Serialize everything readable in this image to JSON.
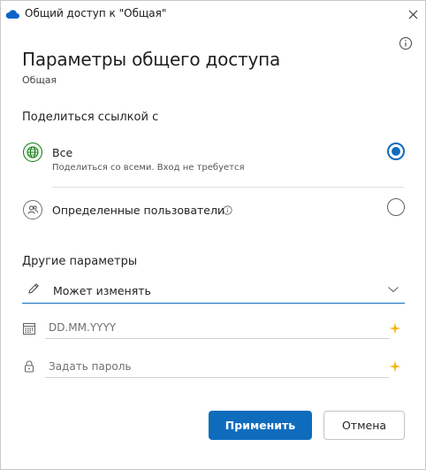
{
  "window": {
    "title": "Общий доступ к \"Общая\""
  },
  "header": {
    "title": "Параметры общего доступа",
    "subtitle": "Общая"
  },
  "share_link": {
    "label": "Поделиться ссылкой с",
    "options": [
      {
        "title": "Все",
        "description": "Поделиться со всеми. Вход не требуется",
        "selected": true,
        "icon": "globe-icon"
      },
      {
        "title": "Определенные пользователи",
        "selected": false,
        "icon": "people-icon"
      }
    ]
  },
  "other_settings": {
    "label": "Другие параметры",
    "permission": {
      "value": "Может изменять",
      "icon": "pencil-icon"
    },
    "expiry_date": {
      "placeholder": "DD.MM.YYYY",
      "icon": "calendar-icon"
    },
    "password": {
      "placeholder": "Задать пароль",
      "icon": "lock-icon"
    }
  },
  "buttons": {
    "apply": "Применить",
    "cancel": "Отмена"
  },
  "colors": {
    "accent": "#0f6cbd",
    "globe_green": "#107c10",
    "sparkle_gold": "#f2b705"
  }
}
